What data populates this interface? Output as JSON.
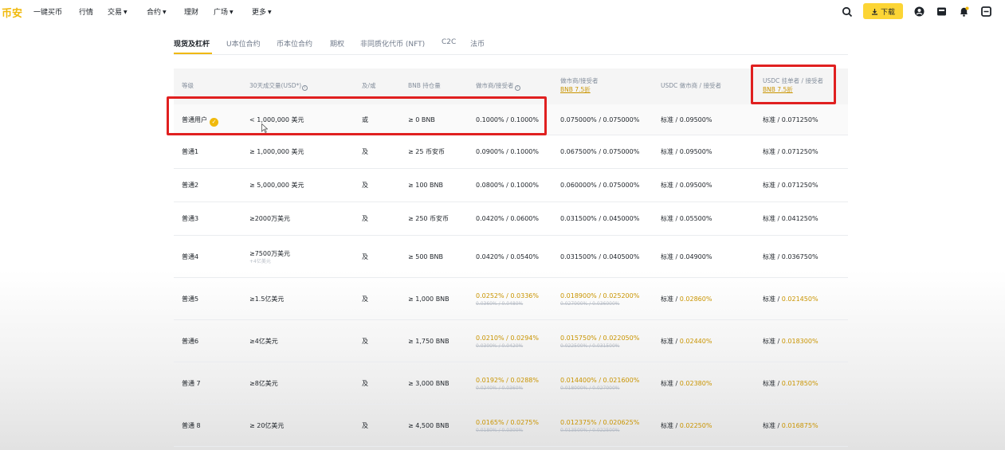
{
  "nav": {
    "logo": "币安",
    "items": [
      {
        "label": "一键买币",
        "caret": false
      },
      {
        "label": "行情",
        "caret": false
      },
      {
        "label": "交易",
        "caret": true
      },
      {
        "label": "合约",
        "caret": true
      },
      {
        "label": "理财",
        "caret": false
      },
      {
        "label": "广场",
        "caret": true
      },
      {
        "label": "更多",
        "caret": true
      }
    ],
    "download_label": "下载",
    "icons": [
      "search-icon",
      "download-icon",
      "user-icon",
      "wallet-icon",
      "bell-icon",
      "scan-icon"
    ]
  },
  "tabs": [
    {
      "label": "现货及杠杆",
      "active": true
    },
    {
      "label": "U本位合约",
      "active": false
    },
    {
      "label": "币本位合约",
      "active": false
    },
    {
      "label": "期权",
      "active": false
    },
    {
      "label": "非同质化代币 (NFT)",
      "active": false
    },
    {
      "label": "C2C",
      "active": false
    },
    {
      "label": "法币",
      "active": false
    }
  ],
  "table": {
    "headers": {
      "tier": "等级",
      "volume": "30天成交量(USD*)",
      "and_or": "及/或",
      "bnb": "BNB 持仓量",
      "maker_taker": "做市商/接受者",
      "maker_taker_bnb": "做市商/接受者",
      "maker_taker_bnb_sub": "BNB 7.5折",
      "usdc": "USDC 做市商 / 接受者",
      "usdc_bnb": "USDC 挂单者 / 接受者",
      "usdc_bnb_sub": "BNB 7.5折"
    },
    "rows": [
      {
        "tier": "普通用户",
        "badge": true,
        "volume": "< 1,000,000 美元",
        "volume_note": "",
        "and_or": "或",
        "bnb": "≥ 0 BNB",
        "fee": "0.1000% / 0.1000%",
        "fee_old": "",
        "fee_bnb": "0.075000% / 0.075000%",
        "fee_bnb_old": "",
        "usdc_prefix": "标准 / ",
        "usdc": "0.09500%",
        "usdc_bnb_prefix": "标准 / ",
        "usdc_bnb": "0.071250%",
        "discount": false
      },
      {
        "tier": "普通1",
        "badge": false,
        "volume": "≥ 1,000,000 美元",
        "volume_note": "",
        "and_or": "及",
        "bnb": "≥ 25 币安币",
        "fee": "0.0900% / 0.1000%",
        "fee_old": "",
        "fee_bnb": "0.067500% / 0.075000%",
        "fee_bnb_old": "",
        "usdc_prefix": "标准 / ",
        "usdc": "0.09500%",
        "usdc_bnb_prefix": "标准 / ",
        "usdc_bnb": "0.071250%",
        "discount": false
      },
      {
        "tier": "普通2",
        "badge": false,
        "volume": "≥ 5,000,000 美元",
        "volume_note": "",
        "and_or": "及",
        "bnb": "≥ 100 BNB",
        "fee": "0.0800% / 0.1000%",
        "fee_old": "",
        "fee_bnb": "0.060000% / 0.075000%",
        "fee_bnb_old": "",
        "usdc_prefix": "标准 / ",
        "usdc": "0.09500%",
        "usdc_bnb_prefix": "标准 / ",
        "usdc_bnb": "0.071250%",
        "discount": false
      },
      {
        "tier": "普通3",
        "badge": false,
        "volume": "≥2000万美元",
        "volume_note": "",
        "and_or": "及",
        "bnb": "≥ 250 币安币",
        "fee": "0.0420% / 0.0600%",
        "fee_old": "",
        "fee_bnb": "0.031500% / 0.045000%",
        "fee_bnb_old": "",
        "usdc_prefix": "标准 / ",
        "usdc": "0.05500%",
        "usdc_bnb_prefix": "标准 / ",
        "usdc_bnb": "0.041250%",
        "discount": false
      },
      {
        "tier": "普通4",
        "badge": false,
        "volume": "≥7500万美元",
        "volume_note": "+4亿美元",
        "and_or": "及",
        "bnb": "≥ 500 BNB",
        "fee": "0.0420% / 0.0540%",
        "fee_old": "",
        "fee_bnb": "0.031500% / 0.040500%",
        "fee_bnb_old": "",
        "usdc_prefix": "标准 / ",
        "usdc": "0.04900%",
        "usdc_bnb_prefix": "标准 / ",
        "usdc_bnb": "0.036750%",
        "discount": false
      },
      {
        "tier": "普通5",
        "badge": false,
        "volume": "≥1.5亿美元",
        "volume_note": "",
        "and_or": "及",
        "bnb": "≥ 1,000 BNB",
        "fee": "0.0252% / 0.0336%",
        "fee_old": "0.0360% / 0.0480%",
        "fee_bnb": "0.018900% / 0.025200%",
        "fee_bnb_old": "0.027000% / 0.036000%",
        "usdc_prefix": "标准 / ",
        "usdc": "0.02860%",
        "usdc_bnb_prefix": "标准 / ",
        "usdc_bnb": "0.021450%",
        "discount": true
      },
      {
        "tier": "普通6",
        "badge": false,
        "volume": "≥4亿美元",
        "volume_note": "",
        "and_or": "及",
        "bnb": "≥ 1,750 BNB",
        "fee": "0.0210% / 0.0294%",
        "fee_old": "0.0300% / 0.0420%",
        "fee_bnb": "0.015750% / 0.022050%",
        "fee_bnb_old": "0.022500% / 0.031500%",
        "usdc_prefix": "标准 / ",
        "usdc": "0.02440%",
        "usdc_bnb_prefix": "标准 / ",
        "usdc_bnb": "0.018300%",
        "discount": true
      },
      {
        "tier": "普通 7",
        "badge": false,
        "volume": "≥8亿美元",
        "volume_note": "",
        "and_or": "及",
        "bnb": "≥ 3,000 BNB",
        "fee": "0.0192% / 0.0288%",
        "fee_old": "0.0240% / 0.0360%",
        "fee_bnb": "0.014400% / 0.021600%",
        "fee_bnb_old": "0.018000% / 0.027000%",
        "usdc_prefix": "标准 / ",
        "usdc": "0.02380%",
        "usdc_bnb_prefix": "标准 / ",
        "usdc_bnb": "0.017850%",
        "discount": true
      },
      {
        "tier": "普通 8",
        "badge": false,
        "volume": "≥ 20亿美元",
        "volume_note": "",
        "and_or": "及",
        "bnb": "≥ 4,500 BNB",
        "fee": "0.0165% / 0.0275%",
        "fee_old": "0.0180% / 0.0300%",
        "fee_bnb": "0.012375% / 0.020625%",
        "fee_bnb_old": "0.013500% / 0.022500%",
        "usdc_prefix": "标准 / ",
        "usdc": "0.02250%",
        "usdc_bnb_prefix": "标准 / ",
        "usdc_bnb": "0.016875%",
        "discount": true
      }
    ]
  },
  "colors": {
    "accent": "#f0b90b",
    "annotation": "#e02020",
    "discount": "#c99400"
  }
}
